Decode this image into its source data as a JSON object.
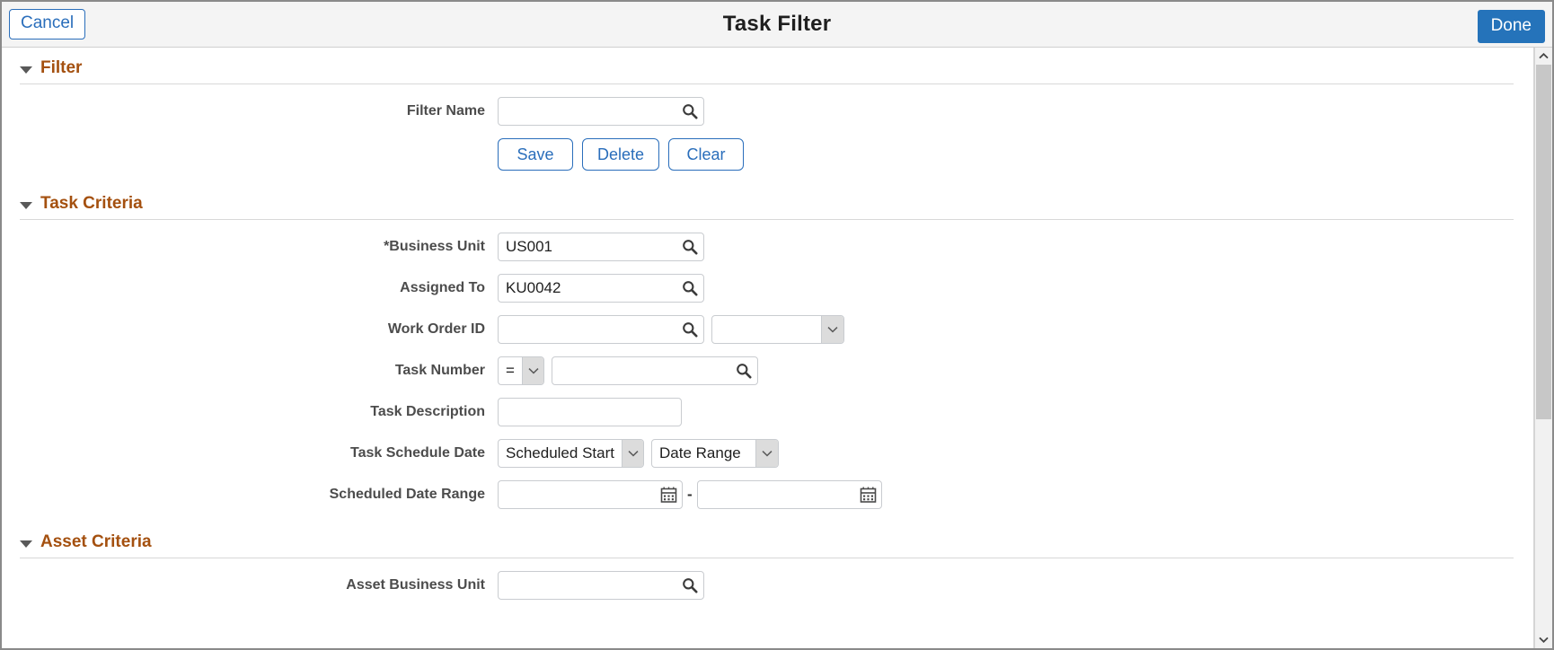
{
  "header": {
    "cancel_label": "Cancel",
    "title": "Task Filter",
    "done_label": "Done"
  },
  "sections": {
    "filter": {
      "title": "Filter",
      "filter_name_label": "Filter Name",
      "filter_name_value": "",
      "save_label": "Save",
      "delete_label": "Delete",
      "clear_label": "Clear"
    },
    "task_criteria": {
      "title": "Task Criteria",
      "business_unit_label": "*Business Unit",
      "business_unit_value": "US001",
      "assigned_to_label": "Assigned To",
      "assigned_to_value": "KU0042",
      "work_order_id_label": "Work Order ID",
      "work_order_id_value": "",
      "work_order_type_value": "",
      "task_number_label": "Task Number",
      "task_number_operator": "=",
      "task_number_value": "",
      "task_description_label": "Task Description",
      "task_description_value": "",
      "task_schedule_date_label": "Task Schedule Date",
      "task_schedule_date_type": "Scheduled Start",
      "task_schedule_date_range_type": "Date Range",
      "scheduled_date_range_label": "Scheduled Date Range",
      "scheduled_date_from": "",
      "scheduled_date_to": "",
      "date_range_separator": "-"
    },
    "asset_criteria": {
      "title": "Asset Criteria",
      "asset_business_unit_label": "Asset Business Unit",
      "asset_business_unit_value": ""
    }
  },
  "colors": {
    "accent_blue": "#2573ba",
    "link_blue": "#2a6ebb",
    "section_header": "#a4500f",
    "label_gray": "#4c4c4c",
    "header_bg": "#f4f4f4"
  },
  "icons": {
    "prompt": "search-icon",
    "calendar": "calendar-icon",
    "chevron_down": "chevron-down-icon",
    "caret_down": "caret-down-icon",
    "scroll_up": "chevron-up-icon",
    "scroll_down": "chevron-down-icon"
  }
}
